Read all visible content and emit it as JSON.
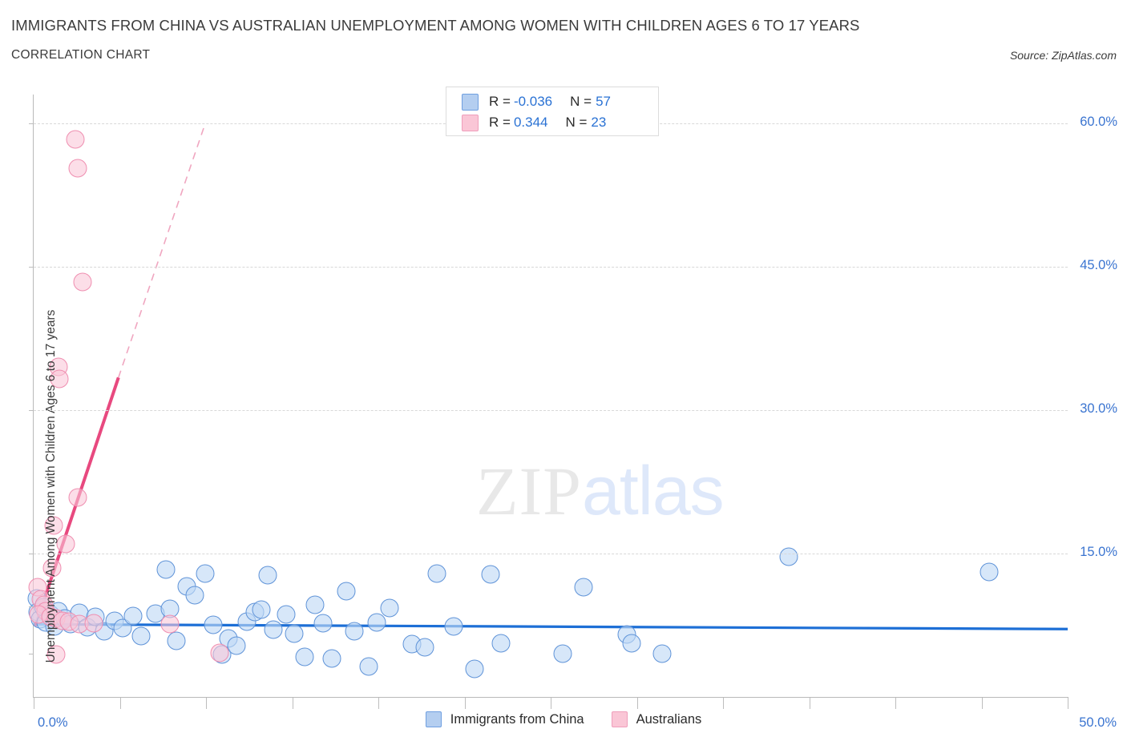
{
  "header": {
    "title": "IMMIGRANTS FROM CHINA VS AUSTRALIAN UNEMPLOYMENT AMONG WOMEN WITH CHILDREN AGES 6 TO 17 YEARS",
    "subtitle": "CORRELATION CHART",
    "source": "Source: ZipAtlas.com"
  },
  "watermark": {
    "part1": "ZIP",
    "part2": "atlas"
  },
  "stats": {
    "rows": [
      {
        "series": "Immigrants from China",
        "color": "#b4cef0",
        "r_label": "R =",
        "r_value": "-0.036",
        "n_label": "N =",
        "n_value": "57"
      },
      {
        "series": "Australians",
        "color": "#fac6d6",
        "r_label": "R =",
        "r_value": "0.344",
        "n_label": "N =",
        "n_value": "23"
      }
    ]
  },
  "legend": {
    "items": [
      {
        "label": "Immigrants from China",
        "color": "#b4cef0"
      },
      {
        "label": "Australians",
        "color": "#fac6d6"
      }
    ]
  },
  "chart_data": {
    "type": "scatter",
    "title": "IMMIGRANTS FROM CHINA VS AUSTRALIAN UNEMPLOYMENT AMONG WOMEN WITH CHILDREN AGES 6 TO 17 YEARS",
    "subtitle": "CORRELATION CHART",
    "xlabel": "Immigrants from China",
    "ylabel": "Unemployment Among Women with Children Ages 6 to 17 years",
    "xlim": [
      0.0,
      50.0
    ],
    "ylim": [
      0.0,
      63.0
    ],
    "x_tick_labels": [
      "0.0%",
      "50.0%"
    ],
    "y_tick_labels": [
      "15.0%",
      "30.0%",
      "45.0%",
      "60.0%"
    ],
    "y_ticks": [
      15.0,
      30.0,
      45.0,
      60.0
    ],
    "grid": "horizontal-dashed",
    "legend_position": "bottom-center",
    "series": [
      {
        "name": "Immigrants from China",
        "color": "#b4cef0",
        "edge_color": "#5f93d8",
        "r": -0.036,
        "n": 57,
        "trendline": {
          "style": "solid",
          "x0": 0.0,
          "y0": 7.6,
          "x1": 50.0,
          "y1": 7.1
        },
        "points": [
          {
            "x": 0.15,
            "y": 10.3
          },
          {
            "x": 0.2,
            "y": 8.9
          },
          {
            "x": 0.3,
            "y": 8.1
          },
          {
            "x": 0.45,
            "y": 9.4
          },
          {
            "x": 0.6,
            "y": 7.8
          },
          {
            "x": 0.8,
            "y": 8.6
          },
          {
            "x": 1.0,
            "y": 7.4
          },
          {
            "x": 1.2,
            "y": 9.0
          },
          {
            "x": 1.5,
            "y": 8.2
          },
          {
            "x": 1.8,
            "y": 7.6
          },
          {
            "x": 2.2,
            "y": 8.8
          },
          {
            "x": 2.6,
            "y": 7.3
          },
          {
            "x": 3.0,
            "y": 8.4
          },
          {
            "x": 3.4,
            "y": 6.9
          },
          {
            "x": 3.9,
            "y": 8.0
          },
          {
            "x": 4.3,
            "y": 7.2
          },
          {
            "x": 4.8,
            "y": 8.5
          },
          {
            "x": 5.2,
            "y": 6.4
          },
          {
            "x": 5.9,
            "y": 8.7
          },
          {
            "x": 6.4,
            "y": 13.3
          },
          {
            "x": 6.6,
            "y": 9.2
          },
          {
            "x": 6.9,
            "y": 5.9
          },
          {
            "x": 7.4,
            "y": 11.6
          },
          {
            "x": 7.8,
            "y": 10.6
          },
          {
            "x": 8.3,
            "y": 12.9
          },
          {
            "x": 8.7,
            "y": 7.5
          },
          {
            "x": 9.1,
            "y": 4.4
          },
          {
            "x": 9.4,
            "y": 6.1
          },
          {
            "x": 9.8,
            "y": 5.4
          },
          {
            "x": 10.3,
            "y": 7.9
          },
          {
            "x": 10.7,
            "y": 8.9
          },
          {
            "x": 11.0,
            "y": 9.1
          },
          {
            "x": 11.3,
            "y": 12.7
          },
          {
            "x": 11.6,
            "y": 7.0
          },
          {
            "x": 12.2,
            "y": 8.6
          },
          {
            "x": 12.6,
            "y": 6.6
          },
          {
            "x": 13.1,
            "y": 4.2
          },
          {
            "x": 13.6,
            "y": 9.6
          },
          {
            "x": 14.0,
            "y": 7.7
          },
          {
            "x": 14.4,
            "y": 4.0
          },
          {
            "x": 15.1,
            "y": 11.1
          },
          {
            "x": 15.5,
            "y": 6.9
          },
          {
            "x": 16.2,
            "y": 3.2
          },
          {
            "x": 16.6,
            "y": 7.8
          },
          {
            "x": 17.2,
            "y": 9.3
          },
          {
            "x": 18.3,
            "y": 5.5
          },
          {
            "x": 18.9,
            "y": 5.2
          },
          {
            "x": 19.5,
            "y": 12.9
          },
          {
            "x": 20.3,
            "y": 7.4
          },
          {
            "x": 21.3,
            "y": 2.9
          },
          {
            "x": 22.1,
            "y": 12.8
          },
          {
            "x": 22.6,
            "y": 5.6
          },
          {
            "x": 25.6,
            "y": 4.5
          },
          {
            "x": 26.6,
            "y": 11.5
          },
          {
            "x": 28.7,
            "y": 6.5
          },
          {
            "x": 28.9,
            "y": 5.6
          },
          {
            "x": 30.4,
            "y": 4.5
          },
          {
            "x": 36.5,
            "y": 14.7
          },
          {
            "x": 46.2,
            "y": 13.1
          }
        ]
      },
      {
        "name": "Australians",
        "color": "#fac6d6",
        "edge_color": "#ef8eb0",
        "r": 0.344,
        "n": 23,
        "trendline": {
          "style": "solid",
          "x0": 0.08,
          "y0": 7.4,
          "x1": 4.1,
          "y1": 33.4
        },
        "trendline_extension": {
          "style": "dashed",
          "x0": 4.1,
          "y0": 33.4,
          "x1": 8.3,
          "y1": 60.0
        },
        "points": [
          {
            "x": 2.0,
            "y": 58.3
          },
          {
            "x": 2.15,
            "y": 55.3
          },
          {
            "x": 2.35,
            "y": 43.4
          },
          {
            "x": 1.2,
            "y": 34.5
          },
          {
            "x": 1.25,
            "y": 33.3
          },
          {
            "x": 2.15,
            "y": 20.9
          },
          {
            "x": 0.95,
            "y": 17.9
          },
          {
            "x": 1.55,
            "y": 16.0
          },
          {
            "x": 0.9,
            "y": 13.5
          },
          {
            "x": 0.2,
            "y": 11.5
          },
          {
            "x": 0.35,
            "y": 10.2
          },
          {
            "x": 0.5,
            "y": 9.6
          },
          {
            "x": 0.6,
            "y": 9.0
          },
          {
            "x": 0.25,
            "y": 8.6
          },
          {
            "x": 0.8,
            "y": 8.4
          },
          {
            "x": 1.1,
            "y": 8.2
          },
          {
            "x": 1.4,
            "y": 8.0
          },
          {
            "x": 1.7,
            "y": 7.9
          },
          {
            "x": 2.2,
            "y": 7.6
          },
          {
            "x": 2.9,
            "y": 7.7
          },
          {
            "x": 6.6,
            "y": 7.6
          },
          {
            "x": 1.1,
            "y": 4.4
          },
          {
            "x": 9.0,
            "y": 4.6
          }
        ]
      }
    ]
  }
}
